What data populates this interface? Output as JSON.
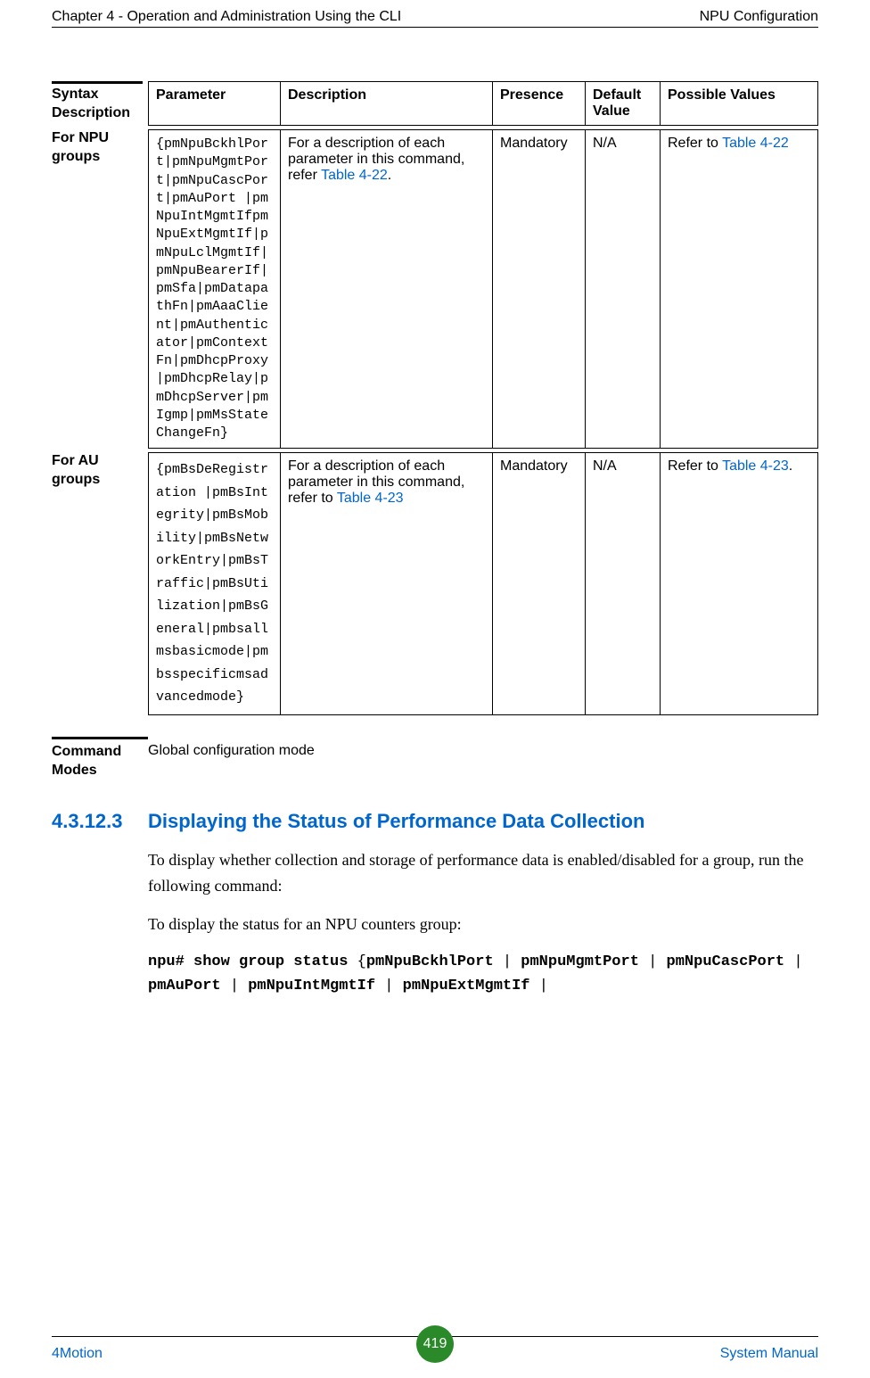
{
  "running_head": {
    "left": "Chapter 4 - Operation and Administration Using the CLI",
    "right": "NPU Configuration"
  },
  "labels": {
    "syntax_description": "Syntax Description",
    "for_npu_groups": "For NPU groups",
    "for_au_groups": "For AU groups",
    "command_modes": "Command Modes"
  },
  "table": {
    "headers": {
      "parameter": "Parameter",
      "description": "Description",
      "presence": "Presence",
      "default_value": "Default Value",
      "possible_values": "Possible Values"
    },
    "rows": {
      "npu": {
        "parameter": "{pmNpuBckhlPort|pmNpuMgmtPort|pmNpuCascPort|pmAuPort |pmNpuIntMgmtIfpmNpuExtMgmtIf|pmNpuLclMgmtIf|pmNpuBearerIf|pmSfa|pmDatapathFn|pmAaaClient|pmAuthenticator|pmContextFn|pmDhcpProxy|pmDhcpRelay|pmDhcpServer|pmIgmp|pmMsStateChangeFn}",
        "description_pre": "For a description of each parameter in this command, refer ",
        "description_link": "Table 4-22",
        "description_post": ".",
        "presence": "Mandatory",
        "default_value": "N/A",
        "possible_pre": "Refer to ",
        "possible_link": "Table 4-22"
      },
      "au": {
        "parameter": "{pmBsDeRegistration |pmBsIntegrity|pmBsMobility|pmBsNetworkEntry|pmBsTraffic|pmBsUtilization|pmBsGeneral|pmbsallmsbasicmode|pmbsspecificmsadvancedmode}",
        "description_pre": "For a description of each parameter in this command, refer to ",
        "description_link": "Table 4-23",
        "presence": "Mandatory",
        "default_value": "N/A",
        "possible_pre": "Refer to ",
        "possible_link": "Table 4-23",
        "possible_post": "."
      }
    }
  },
  "command_modes_value": "Global configuration mode",
  "section": {
    "number": "4.3.12.3",
    "title": "Displaying the Status of Performance Data Collection"
  },
  "body": {
    "p1": "To display whether collection and storage of performance data is enabled/disabled for a group, run the following command:",
    "p2": "To display the status for an NPU counters group:"
  },
  "command": {
    "prefix": "npu# show group status ",
    "brace_open": "{",
    "items": [
      "pmNpuBckhlPort",
      "pmNpuMgmtPort",
      "pmNpuCascPort",
      "pmAuPort",
      "pmNpuIntMgmtIf",
      "pmNpuExtMgmtIf"
    ],
    "sep": " | ",
    "trailing": " |"
  },
  "footer": {
    "left": "4Motion",
    "page": "419",
    "right": "System Manual"
  }
}
